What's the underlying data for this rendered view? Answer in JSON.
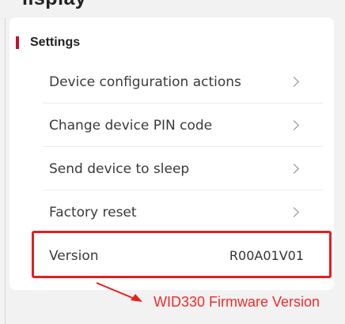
{
  "page": {
    "top_cut_text": "lisplay"
  },
  "settings": {
    "title": "Settings",
    "items": [
      {
        "label": "Device configuration actions",
        "icon": "chevron-right-icon"
      },
      {
        "label": "Change device PIN code",
        "icon": "chevron-right-icon"
      },
      {
        "label": "Send device to sleep",
        "icon": "chevron-right-icon"
      },
      {
        "label": "Factory reset",
        "icon": "chevron-right-icon"
      }
    ],
    "version": {
      "label": "Version",
      "value": "R00A01V01"
    }
  },
  "annotation": {
    "text": "WID330 Firmware Version",
    "color": "#ef2b2b"
  },
  "colors": {
    "accent": "#c8102e",
    "highlight": "#e61e1e",
    "background": "#f2f2f2",
    "card": "#ffffff"
  }
}
